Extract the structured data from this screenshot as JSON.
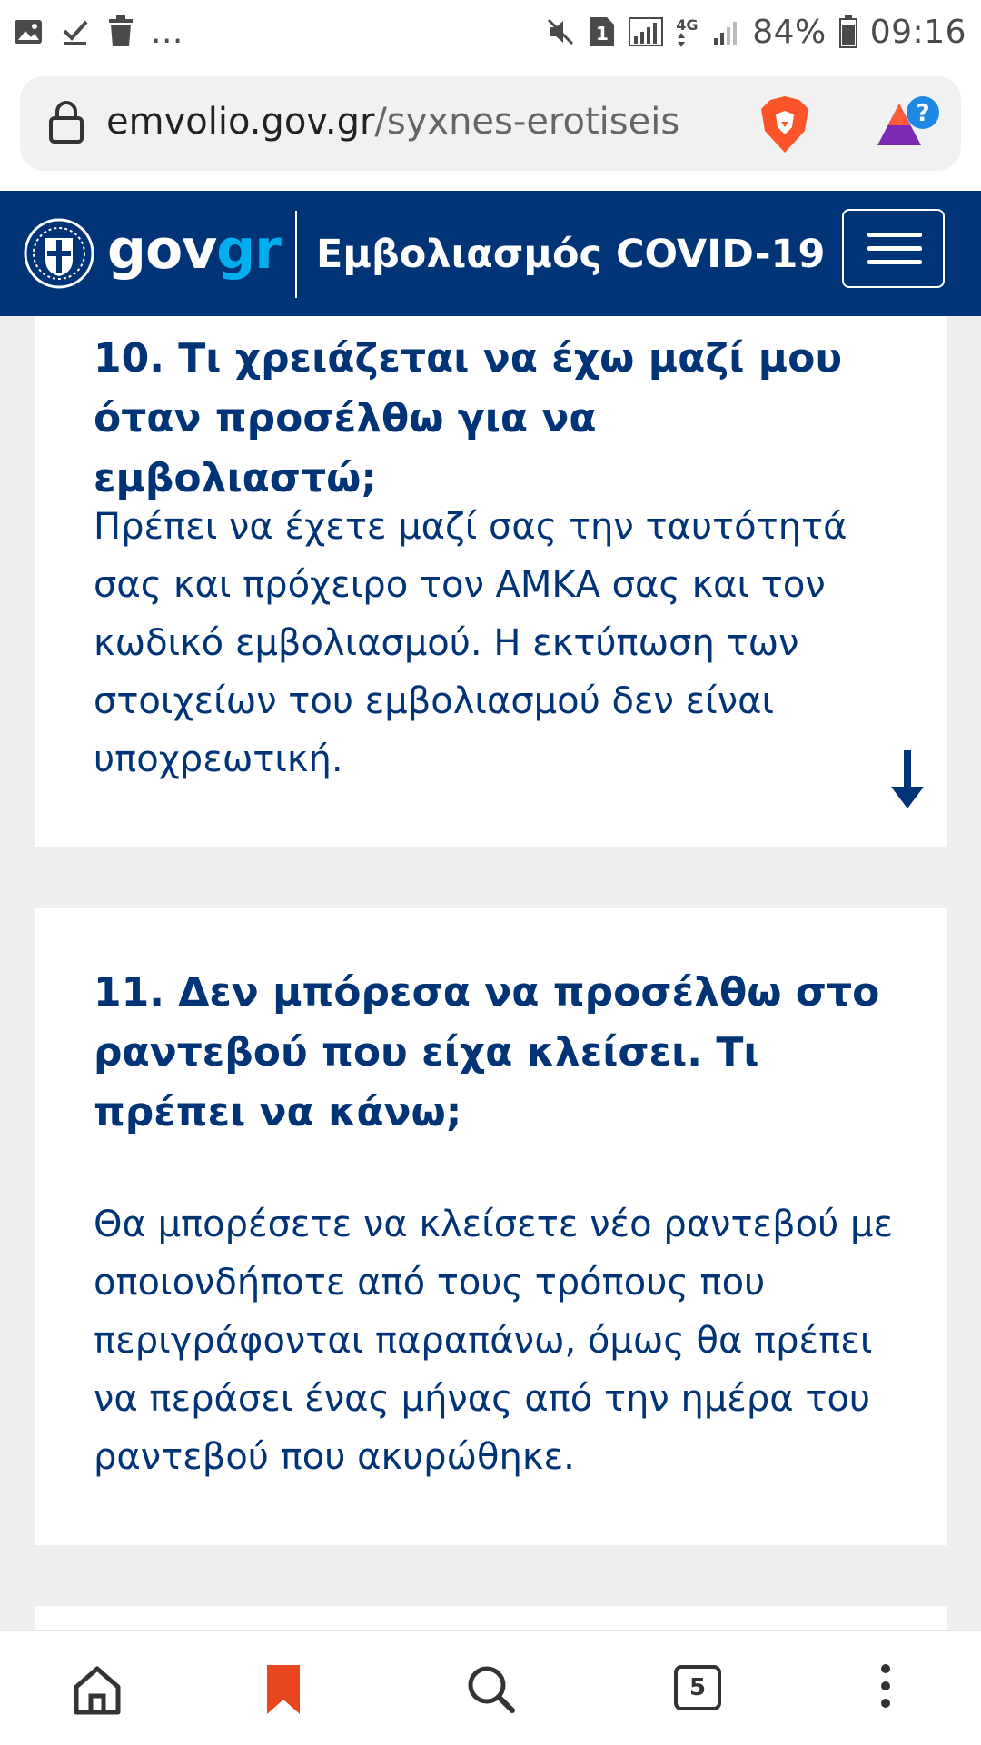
{
  "status_bar": {
    "battery": "84%",
    "time": "09:16",
    "network": "4G",
    "sim_slot": "1",
    "more": "..."
  },
  "url_bar": {
    "domain": "emvolio.gov.gr",
    "path": "/syxnes-erotiseis"
  },
  "header": {
    "brand_gov": "gov",
    "brand_gr": "gr",
    "title": "Εμβολιασμός COVID-19"
  },
  "faq": [
    {
      "question": "10. Τι χρειάζεται να έχω μαζί μου όταν προσέλθω για να εμβολιαστώ;",
      "answer": "Πρέπει να έχετε μαζί σας την ταυτότητά σας και πρόχειρο τον ΑΜΚΑ σας και τον κωδικό εμβολιασμού. Η εκτύπωση των στοιχείων του εμβολιασμού δεν είναι υποχρεωτική."
    },
    {
      "question": "11. Δεν μπόρεσα να προσέλθω στο ραντεβού που είχα κλείσει. Τι πρέπει να κάνω;",
      "answer": "Θα μπορέσετε να κλείσετε νέο ραντεβού με οποιονδήποτε από τους τρόπους που περιγράφονται παραπάνω, όμως θα πρέπει να περάσει ένας μήνας από την ημέρα του ραντεβού που ακυρώθηκε."
    }
  ],
  "bottom_nav": {
    "tab_count": "5"
  },
  "colors": {
    "brand_blue": "#003476",
    "brand_accent": "#00aeef",
    "bookmark_active": "#e8461e"
  }
}
